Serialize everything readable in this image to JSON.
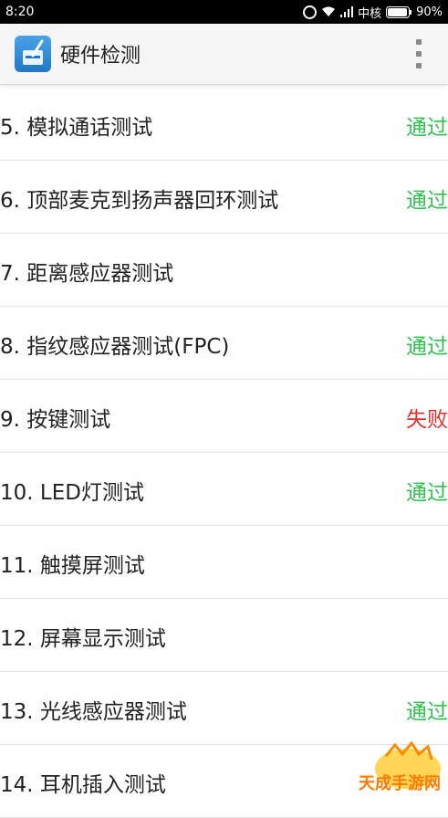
{
  "status_bar": {
    "time": "8:20",
    "carrier": "中核",
    "battery": "90%"
  },
  "app_bar": {
    "title": "硬件检测",
    "icon": "app-logo-icon",
    "menu_icon": "overflow-menu-icon"
  },
  "colors": {
    "pass": "#2ec04f",
    "fail": "#e2302b"
  },
  "tests": [
    {
      "label": "5. 模拟通话测试",
      "status": "通过",
      "state": "pass"
    },
    {
      "label": "6. 顶部麦克到扬声器回环测试",
      "status": "通过",
      "state": "pass"
    },
    {
      "label": "7. 距离感应器测试",
      "status": "",
      "state": "none"
    },
    {
      "label": "8. 指纹感应器测试(FPC)",
      "status": "通过",
      "state": "pass"
    },
    {
      "label": "9. 按键测试",
      "status": "失败",
      "state": "fail"
    },
    {
      "label": "10. LED灯测试",
      "status": "通过",
      "state": "pass"
    },
    {
      "label": "11. 触摸屏测试",
      "status": "",
      "state": "none"
    },
    {
      "label": "12. 屏幕显示测试",
      "status": "",
      "state": "none"
    },
    {
      "label": "13. 光线感应器测试",
      "status": "通过",
      "state": "pass"
    },
    {
      "label": "14. 耳机插入测试",
      "status": "",
      "state": "none"
    }
  ],
  "watermark": {
    "text": "天成手游网"
  }
}
